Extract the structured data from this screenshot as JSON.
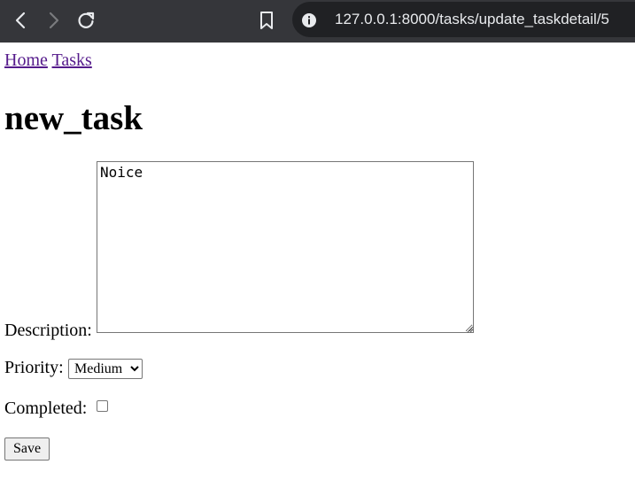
{
  "browser": {
    "url": "127.0.0.1:8000/tasks/update_taskdetail/5"
  },
  "breadcrumb": {
    "home": "Home",
    "tasks": "Tasks"
  },
  "page": {
    "title": "new_task"
  },
  "form": {
    "description_label": "Description:",
    "description_value": "Noice",
    "priority_label": "Priority:",
    "priority_value": "Medium",
    "priority_options": [
      "Medium"
    ],
    "completed_label": "Completed:",
    "completed_checked": false,
    "save_label": "Save"
  },
  "icons": {
    "back": "chevron-left-icon",
    "forward": "chevron-right-icon",
    "reload": "reload-icon",
    "bookmark": "bookmark-icon",
    "site_info": "info-icon"
  },
  "colors": {
    "chrome_bg": "#35363a",
    "omnibox_bg": "#202124",
    "visited_link": "#551a8b"
  }
}
